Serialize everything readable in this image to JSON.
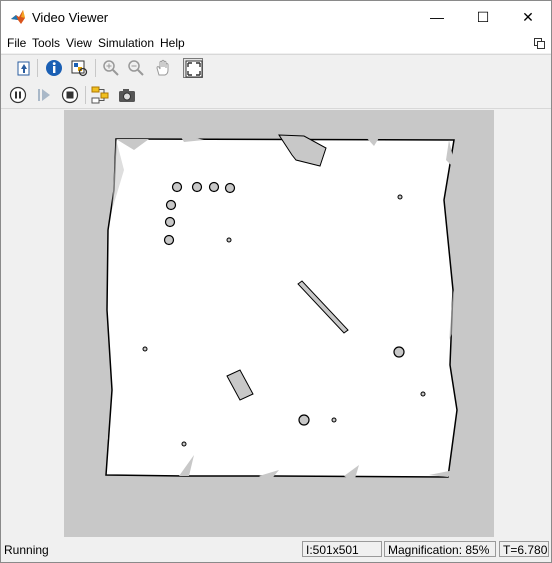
{
  "window": {
    "title": "Video Viewer",
    "controls": {
      "minimize": "—",
      "maximize": "☐",
      "close": "✕"
    }
  },
  "menu": {
    "items": [
      {
        "label": "File"
      },
      {
        "label": "Tools"
      },
      {
        "label": "View"
      },
      {
        "label": "Simulation"
      },
      {
        "label": "Help"
      }
    ]
  },
  "toolbar": {
    "row1": [
      "keep-on-top-icon",
      "info-icon",
      "pixel-region-icon",
      "zoom-in-icon",
      "zoom-out-icon",
      "pan-hand-icon",
      "fit-to-window-icon"
    ],
    "row2": [
      "pause-icon",
      "step-forward-icon",
      "stop-icon",
      "highlight-block-icon",
      "snapshot-icon"
    ]
  },
  "status": {
    "state": "Running",
    "size": "I:501x501",
    "magnification": "Magnification: 85%",
    "time": "T=6.780"
  },
  "colors": {
    "background_frame": "#c8c8c8",
    "map_free": "#ffffff",
    "map_obstacle": "#000000",
    "unknown": "#c8c8c8"
  }
}
